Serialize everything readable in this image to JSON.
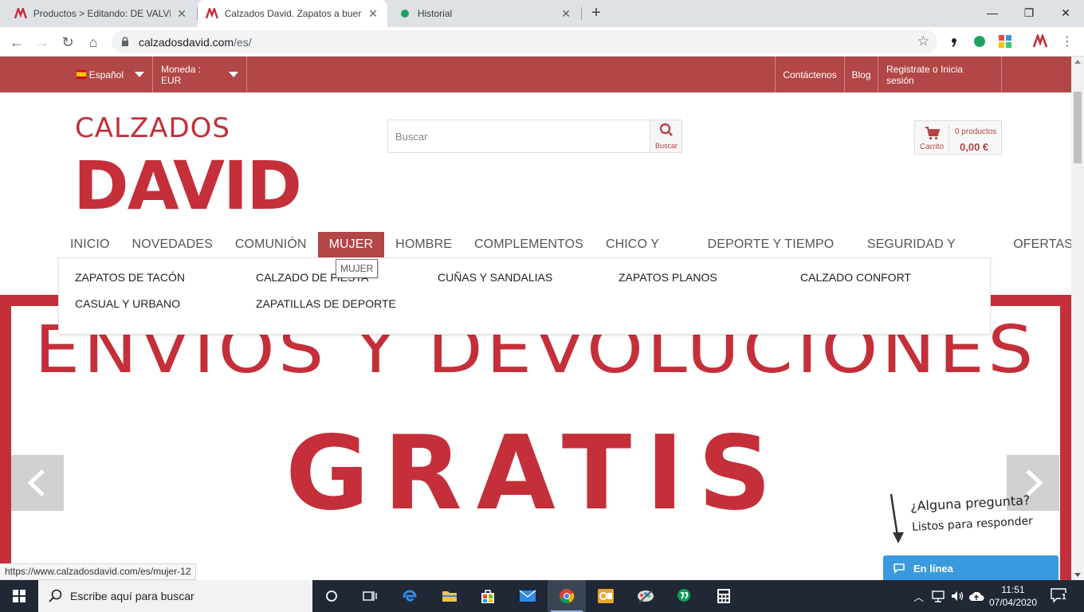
{
  "browser": {
    "tabs": [
      {
        "title": "Productos > Editando: DE VALVERDE",
        "active": false
      },
      {
        "title": "Calzados David. Zapatos a buen precio",
        "active": true
      },
      {
        "title": "Historial",
        "active": false
      }
    ],
    "url_domain": "calzadosdavid.com",
    "url_path": "/es/",
    "status_url": "https://www.calzadosdavid.com/es/mujer-12"
  },
  "topbar": {
    "language": "Español",
    "currency": "Moneda : EUR",
    "contact": "Contáctenos",
    "blog": "Blog",
    "account": "Registrate o Inicia sesión"
  },
  "header": {
    "logo_top": "CALZADOS",
    "logo_bottom": "DAVID",
    "search_placeholder": "Buscar",
    "search_button": "Buscar",
    "cart_label": "Carrito",
    "cart_count": "0 productos",
    "cart_total": "0,00 €"
  },
  "menu": {
    "items": [
      "INICIO",
      "NOVEDADES",
      "COMUNIÓN",
      "MUJER",
      "HOMBRE",
      "COMPLEMENTOS",
      "CHICO Y CHICA",
      "DEPORTE Y TIEMPO LIBRE",
      "SEGURIDAD Y TRABAJO",
      "OFERTAS"
    ],
    "active": "MUJER",
    "tooltip": "MUJER"
  },
  "submenu": {
    "items": [
      "ZAPATOS DE TACÓN",
      "CALZADO DE FIESTA",
      "CUÑAS Y SANDALIAS",
      "ZAPATOS PLANOS",
      "CALZADO CONFORT",
      "CASUAL Y URBANO",
      "ZAPATILLAS DE DEPORTE"
    ]
  },
  "banner": {
    "line1": "ENVIOS Y DEVOLUCIONES",
    "line2": "GRATIS"
  },
  "chat": {
    "question": "¿Alguna pregunta?",
    "subtitle": "Listos para responder",
    "button": "En línea"
  },
  "taskbar": {
    "search_placeholder": "Escribe aquí para buscar",
    "time": "11:51",
    "date": "07/04/2020",
    "notifications": "1"
  },
  "colors": {
    "brand": "#b34646",
    "banner_red": "#c42f39",
    "chat_blue": "#3a9ae0"
  }
}
